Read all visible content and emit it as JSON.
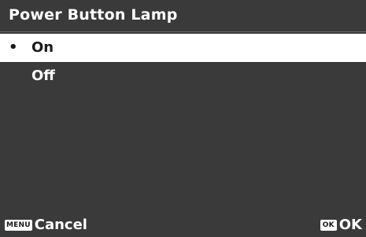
{
  "screen": {
    "title": "Power Button Lamp"
  },
  "menu": {
    "items": [
      {
        "bullet": "•",
        "label": "On",
        "selected": true
      },
      {
        "bullet": "",
        "label": "Off",
        "selected": false
      }
    ]
  },
  "footer": {
    "cancel": {
      "key": "MENU",
      "label": "Cancel"
    },
    "confirm": {
      "key": "OK",
      "label": "OK"
    }
  },
  "colors": {
    "background": "#3a3a3a",
    "highlight": "#ffffff",
    "text": "#ffffff",
    "highlight_text": "#1a1a1a"
  }
}
